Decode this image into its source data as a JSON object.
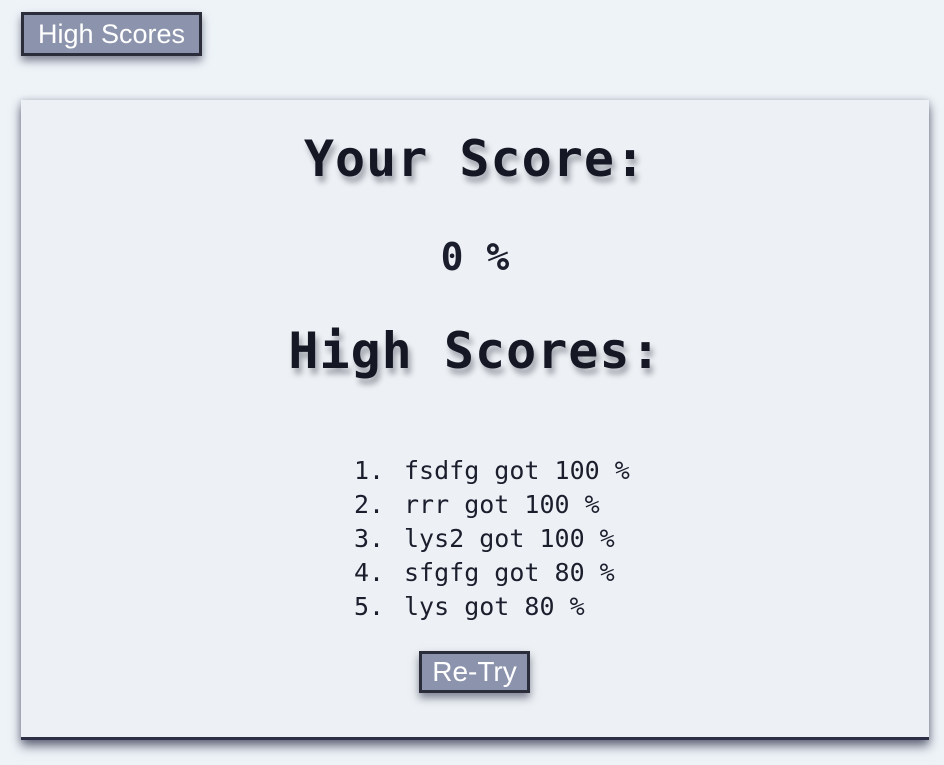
{
  "header": {
    "high_scores_button": "High Scores"
  },
  "results": {
    "your_score_title": "Your Score:",
    "score_value": "0 %",
    "high_scores_title": "High Scores:",
    "high_scores": [
      {
        "rank": "1.",
        "text": "fsdfg got 100 %"
      },
      {
        "rank": "2.",
        "text": "rrr got 100 %"
      },
      {
        "rank": "3.",
        "text": "lys2 got 100 %"
      },
      {
        "rank": "4.",
        "text": "sfgfg got 80 %"
      },
      {
        "rank": "5.",
        "text": "lys got 80 %"
      }
    ],
    "retry_button": "Re-Try"
  },
  "colors": {
    "page_background": "#eef3f8",
    "panel_background": "#edf1f5",
    "button_background": "#8c94ad",
    "button_border": "#2b2d3a",
    "text": "#151824"
  }
}
